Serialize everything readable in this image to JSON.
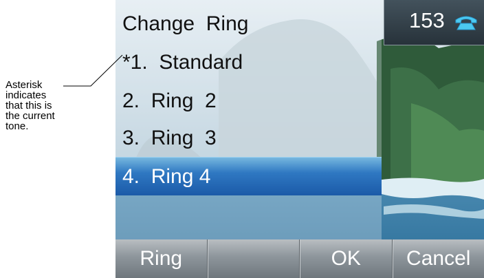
{
  "annotation": {
    "lines": [
      "Asterisk",
      "indicates",
      "that this is",
      "the current",
      "tone."
    ]
  },
  "screen": {
    "title": "Change  Ring",
    "items": [
      {
        "label": "*1.  Standard",
        "selected": false
      },
      {
        "label": "2.  Ring  2",
        "selected": false
      },
      {
        "label": "3.  Ring  3",
        "selected": false
      },
      {
        "label": "4.  Ring 4",
        "selected": true
      }
    ],
    "status": {
      "extension": "153",
      "icon": "phone-handset-icon"
    },
    "softkeys": [
      "Ring",
      "",
      "OK",
      "Cancel"
    ]
  }
}
